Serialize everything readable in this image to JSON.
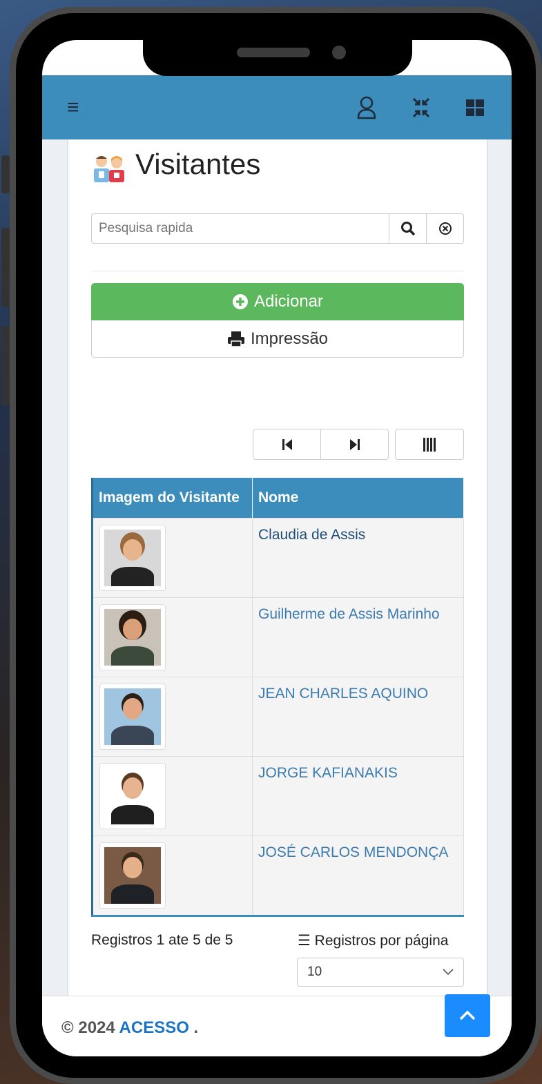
{
  "header": {
    "menu_icon": "hamburger-icon",
    "user_icon": "user-icon",
    "compress_icon": "compress-icon",
    "apps_icon": "grid-icon"
  },
  "page": {
    "title": "Visitantes",
    "title_icon": "visitors-icon"
  },
  "search": {
    "placeholder": "Pesquisa rapida",
    "search_icon": "search-icon",
    "clear_icon": "clear-icon"
  },
  "actions": {
    "add_label": "Adicionar",
    "print_label": "Impressão"
  },
  "navigation": {
    "first_icon": "first-page-icon",
    "last_icon": "last-page-icon",
    "columns_icon": "columns-icon"
  },
  "table": {
    "headers": [
      "Imagem do Visitante",
      "Nome"
    ],
    "rows": [
      {
        "name": "Claudia de Assis"
      },
      {
        "name": "Guilherme de Assis Marinho"
      },
      {
        "name": "JEAN CHARLES AQUINO"
      },
      {
        "name": "JORGE KAFIANAKIS"
      },
      {
        "name": "JOSÉ CARLOS MENDONÇA"
      }
    ]
  },
  "pagination": {
    "records_text": "Registros 1 ate 5 de 5",
    "per_page_label": "Registros por página",
    "per_page_value": "10"
  },
  "footer": {
    "copyright": "© 2024",
    "brand": "ACESSO",
    "suffix": " ."
  },
  "colors": {
    "header": "#3c8dbc",
    "add_button": "#5cb85c",
    "link": "#3c7bb0",
    "scroll_top": "#1a8cff"
  }
}
